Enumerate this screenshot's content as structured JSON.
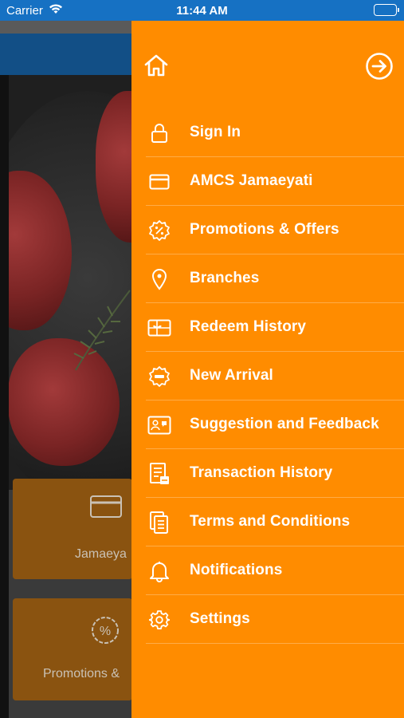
{
  "status_bar": {
    "carrier": "Carrier",
    "time": "11:44 AM"
  },
  "background": {
    "tile1_label": "Jamaeya",
    "tile2_label": "Promotions &"
  },
  "drawer": {
    "home_icon": "home-icon",
    "logout_icon": "arrow-circle-right-icon",
    "menu": [
      {
        "id": "sign-in",
        "label": "Sign In",
        "icon": "lock-icon"
      },
      {
        "id": "amcs-jamaeyati",
        "label": "AMCS Jamaeyati",
        "icon": "card-icon"
      },
      {
        "id": "promotions",
        "label": "Promotions & Offers",
        "icon": "percent-badge-icon"
      },
      {
        "id": "branches",
        "label": "Branches",
        "icon": "location-pin-icon"
      },
      {
        "id": "redeem-history",
        "label": "Redeem History",
        "icon": "gift-card-icon"
      },
      {
        "id": "new-arrival",
        "label": "New Arrival",
        "icon": "new-badge-icon"
      },
      {
        "id": "suggestion",
        "label": "Suggestion and Feedback",
        "icon": "feedback-icon"
      },
      {
        "id": "transaction-history",
        "label": "Transaction History",
        "icon": "receipt-icon"
      },
      {
        "id": "terms",
        "label": "Terms and Conditions",
        "icon": "documents-icon"
      },
      {
        "id": "notifications",
        "label": "Notifications",
        "icon": "bell-icon"
      },
      {
        "id": "settings",
        "label": "Settings",
        "icon": "gear-icon"
      }
    ]
  },
  "colors": {
    "status_bar": "#1671c3",
    "drawer": "#ff8c00",
    "drawer_text": "#ffffff"
  }
}
